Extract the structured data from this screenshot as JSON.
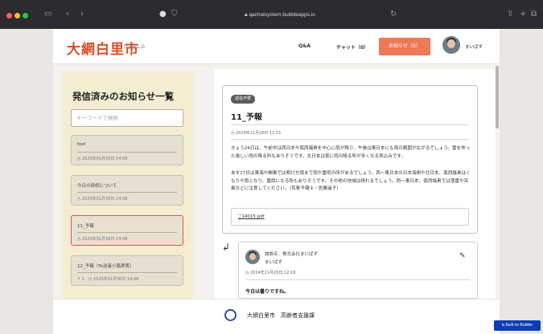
{
  "browser": {
    "url": "qachatsystem.bubbleapps.io",
    "traffic_lights": [
      "#ff5f57",
      "#febc2e",
      "#28c840"
    ]
  },
  "header": {
    "logo_text": "大網白里市",
    "logo_sub": "システム名",
    "nav_qa": "Q&A",
    "nav_chat": "チャット（0）",
    "nav_notice": "お知らせ（0）",
    "user_name": "まいぱず",
    "accent_color": "#ee7857"
  },
  "sidebar": {
    "title": "発信済みのお知らせ一覧",
    "search_placeholder": "キーワードで検索",
    "items": [
      {
        "title": "test",
        "date": "◷ 2025年01月30日 14:08"
      },
      {
        "title": "今日の研修について",
        "date": "◷ 2025年01月30日 14:08"
      },
      {
        "title": "11_予報",
        "date": "◷ 2025年01月30日 14:08"
      },
      {
        "title": "12_予報（To送者小路実篤）",
        "date": "↰ 1　◷ 2025年01月30日 14:08"
      }
    ]
  },
  "detail": {
    "badge": "返信不要",
    "title": "11_予報",
    "date": "◷ 2024年11月26日 11:51",
    "paragraph1": "きょう26日は、午前中は西日本や南西諸島を中心に雨が降り、午後は東日本にも雨の範囲が広がるでしょう。雷を伴った激しい雨の降る所もありそうです。北日本は夜に雨の降る所が多くなる見込みです。",
    "paragraph2": "あす27日は東海や関東では明け方頃まで雨や雷雨の所があるでしょう。西～東日本の日本海側や北日本、南西諸島はくもりや雨となり、雷雨になる所もありそうです。その他の地域は晴れるでしょう。西～東日本、南西諸島では落雷や突風などに注意してください。（気象予報士・佐藤遥子）",
    "attachment": "14015.pdf"
  },
  "comment": {
    "org": "施設名：株式会社まいぱず",
    "name": "まいぱず",
    "date": "◷ 2024年11月26日 12:18",
    "text": "今日は曇りですね。"
  },
  "footer": {
    "org": "大網白里市　高齢者支援課"
  },
  "bubble_badge": "Built on Bubble"
}
